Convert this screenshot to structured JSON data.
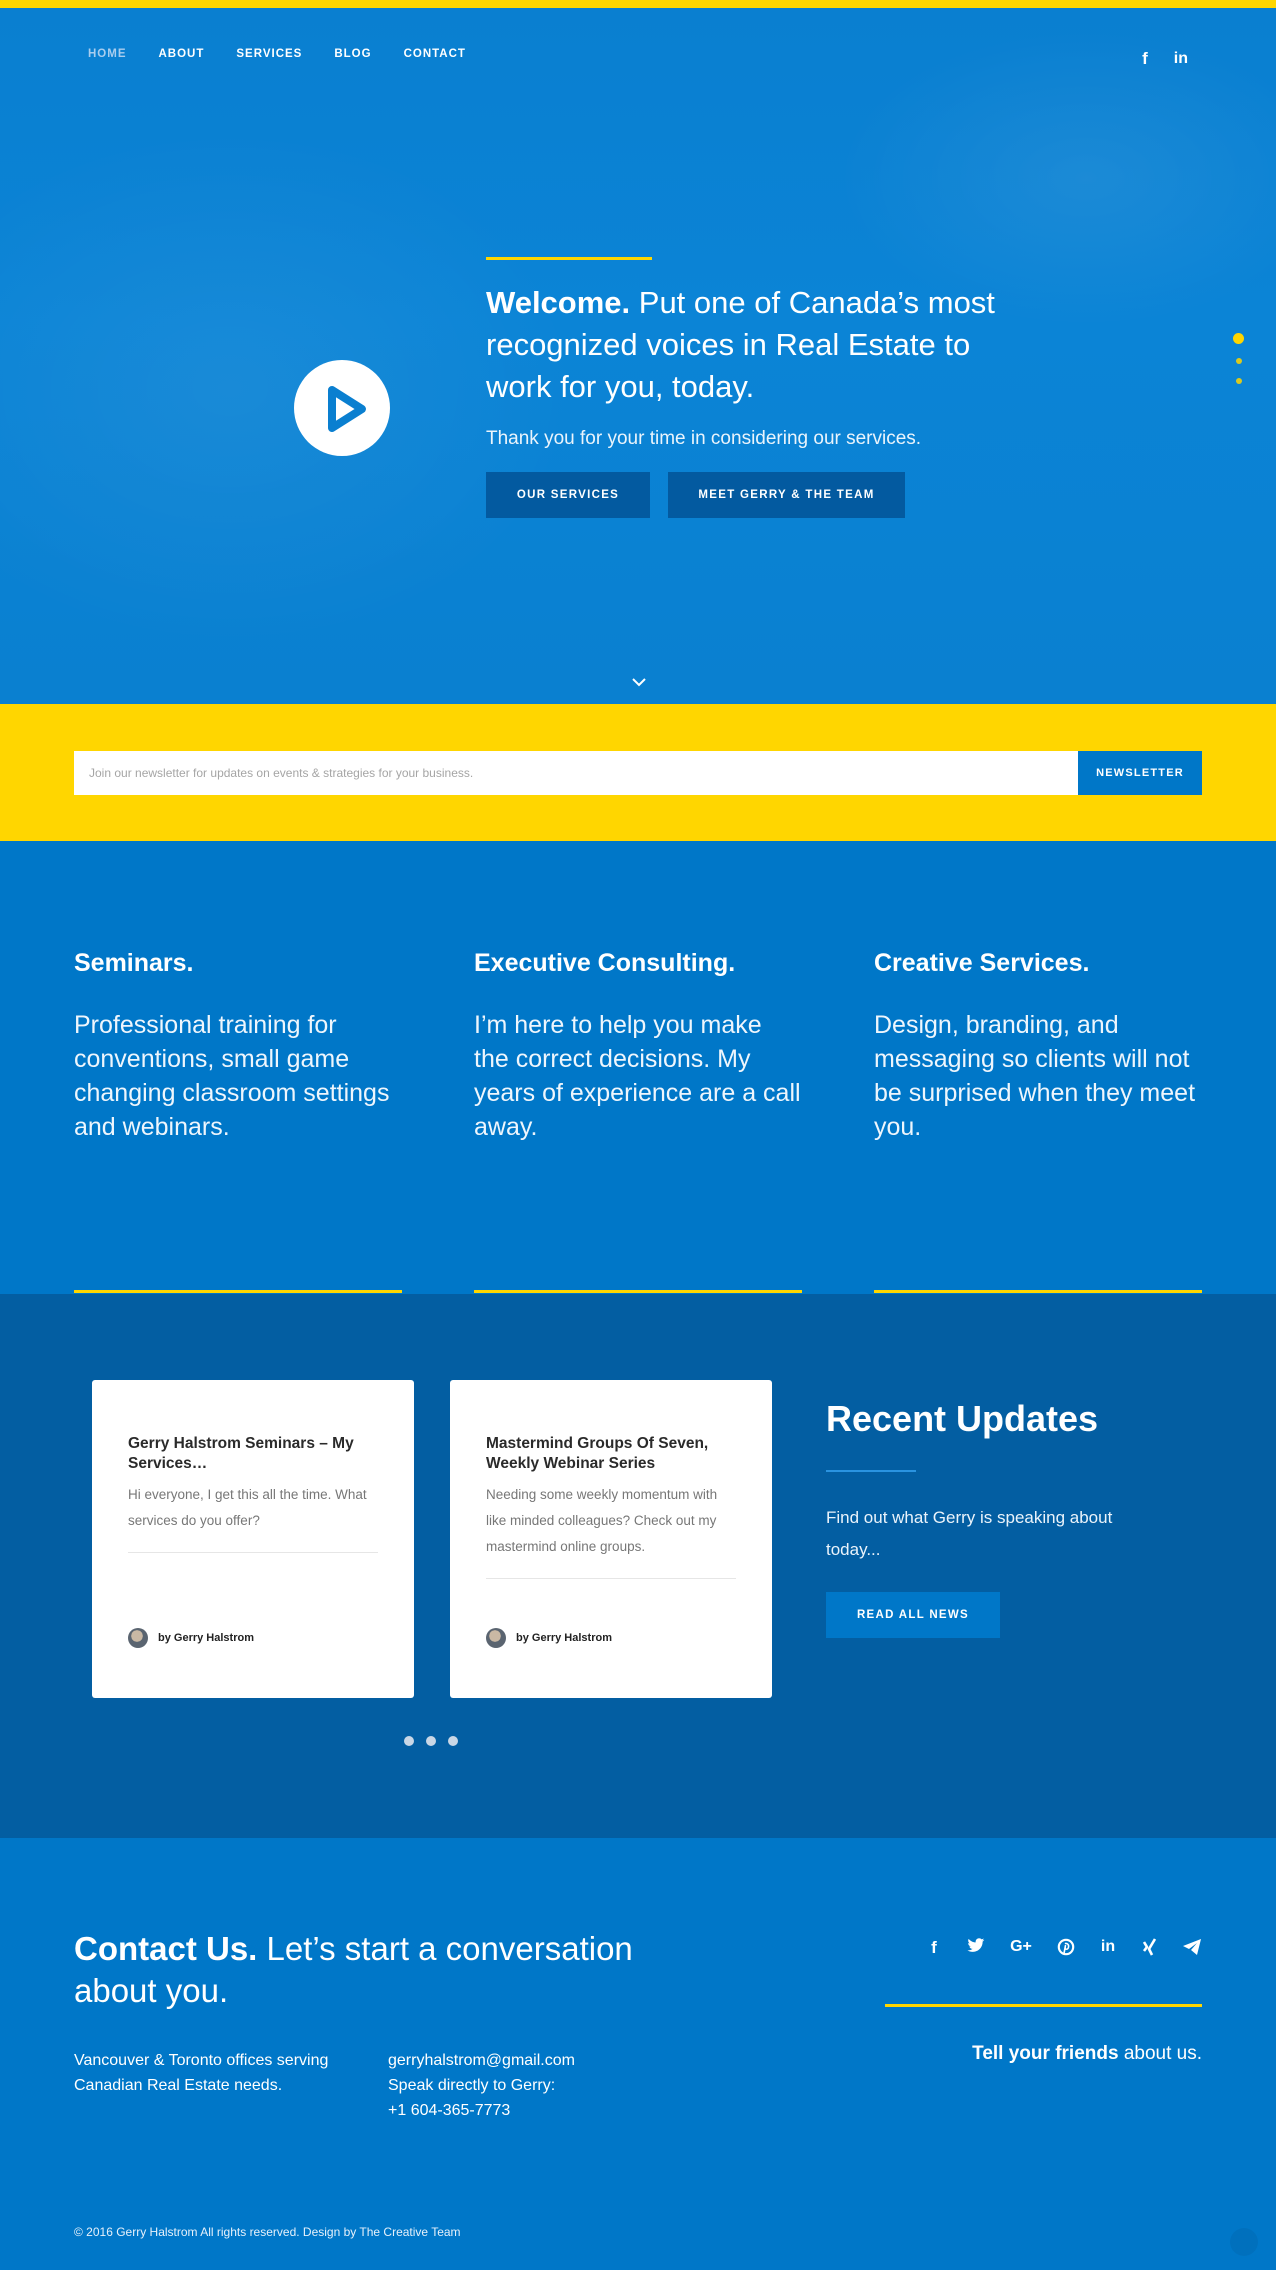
{
  "nav": {
    "items": [
      {
        "label": "HOME",
        "active": true
      },
      {
        "label": "ABOUT"
      },
      {
        "label": "SERVICES"
      },
      {
        "label": "BLOG"
      },
      {
        "label": "CONTACT"
      }
    ],
    "social": [
      "facebook-icon",
      "linkedin-icon"
    ]
  },
  "hero": {
    "title_bold": "Welcome.",
    "title_rest": " Put one of Canada’s most recognized voices in Real Estate to work for you, today.",
    "subtitle": "Thank you for your time in considering our services.",
    "btn_services": "OUR SERVICES",
    "btn_team": "MEET GERRY & THE TEAM",
    "slides": 3,
    "active_slide": 1
  },
  "newsletter": {
    "placeholder": "Join our newsletter for updates on events & strategies for your business.",
    "button": "NEWSLETTER"
  },
  "services": [
    {
      "title": "Seminars.",
      "text": "Professional training for conventions, small game changing classroom settings and webinars."
    },
    {
      "title": "Executive Consulting.",
      "text": "I’m here to help you make the correct decisions. My years of experience are a call away."
    },
    {
      "title": "Creative Services.",
      "text": "Design, branding, and messaging so clients will not be surprised when they meet you."
    }
  ],
  "updates": {
    "cards": [
      {
        "title": "Gerry Halstrom Seminars – My Services…",
        "excerpt": "Hi everyone, I get this all the time. What services do you offer?",
        "author": "by Gerry Halstrom"
      },
      {
        "title": "Mastermind Groups Of Seven, Weekly Webinar Series",
        "excerpt": "Needing some weekly momentum with like minded colleagues? Check out my mastermind online  groups.",
        "author": "by Gerry Halstrom"
      }
    ],
    "heading": "Recent Updates",
    "text": "Find out what Gerry is speaking about today...",
    "button": "READ ALL NEWS",
    "pages": 3
  },
  "contact": {
    "title_bold": "Contact Us.",
    "title_rest": " Let’s start a conversation about you.",
    "offices": "Vancouver & Toronto offices serving Canadian Real Estate needs.",
    "email": "gerryhalstrom@gmail.com",
    "phone_label": "Speak directly to Gerry:",
    "phone": "+1 604-365-7773",
    "share_icons": [
      "facebook-icon",
      "twitter-icon",
      "google-plus-icon",
      "pinterest-icon",
      "linkedin-icon",
      "xing-icon",
      "telegram-icon"
    ],
    "tell_bold": "Tell your friends",
    "tell_rest": " about us.",
    "copyright": "© 2016 Gerry Halstrom All rights reserved. Design by The Creative Team"
  },
  "colors": {
    "yellow": "#ffd600",
    "blue": "#0077c8",
    "dark_blue": "#035ea2"
  }
}
